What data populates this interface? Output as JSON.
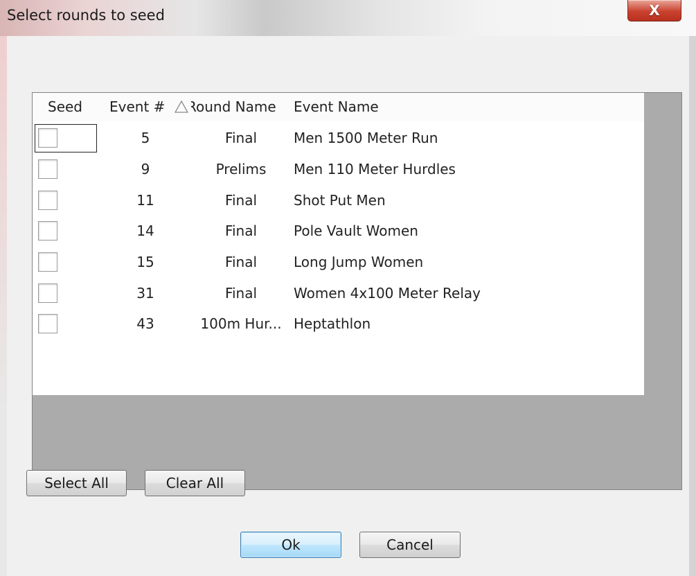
{
  "window": {
    "title": "Select rounds to seed",
    "close_glyph": "X"
  },
  "grid": {
    "columns": {
      "seed": "Seed",
      "event_num": "Event #",
      "round_name": "Round Name",
      "event_name": "Event Name"
    },
    "sort_indicator": "ascending-triangle-icon",
    "rows": [
      {
        "checked": false,
        "event": "5",
        "round": "Final",
        "name": "Men 1500 Meter Run"
      },
      {
        "checked": false,
        "event": "9",
        "round": "Prelims",
        "name": "Men 110 Meter Hurdles"
      },
      {
        "checked": false,
        "event": "11",
        "round": "Final",
        "name": "Shot Put Men"
      },
      {
        "checked": false,
        "event": "14",
        "round": "Final",
        "name": "Pole Vault Women"
      },
      {
        "checked": false,
        "event": "15",
        "round": "Final",
        "name": "Long Jump Women"
      },
      {
        "checked": false,
        "event": "31",
        "round": "Final",
        "name": "Women 4x100 Meter Relay"
      },
      {
        "checked": false,
        "event": "43",
        "round": "100m Hur...",
        "name": "Heptathlon"
      }
    ]
  },
  "buttons": {
    "select_all": "Select All",
    "clear_all": "Clear All",
    "ok": "Ok",
    "cancel": "Cancel"
  },
  "colors": {
    "close_button": "#c9412f",
    "grid_background": "#ababab",
    "default_button_border": "#3c7fb1"
  }
}
